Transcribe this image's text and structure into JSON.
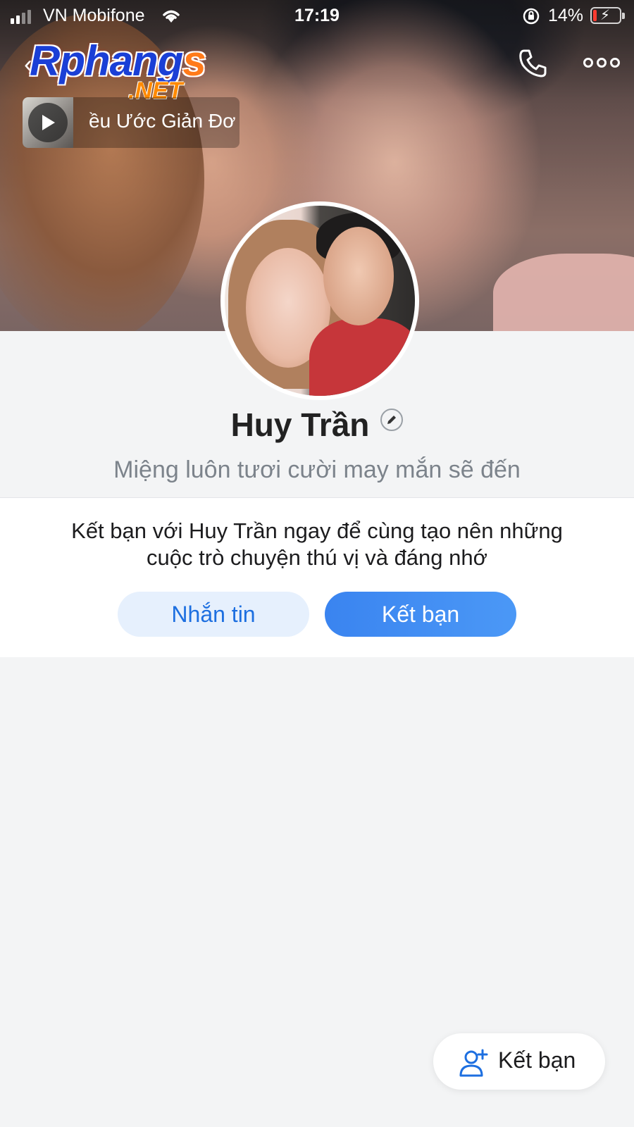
{
  "status_bar": {
    "carrier": "VN Mobifone",
    "time": "17:19",
    "battery_percent": "14%",
    "battery_level": 0.14,
    "icons": [
      "signal-icon",
      "wifi-icon",
      "orientation-lock-icon",
      "battery-charging-icon"
    ]
  },
  "header": {
    "logo_main": "Rphangs",
    "logo_sub": ".NET",
    "icons": [
      "back-icon",
      "phone-icon",
      "more-icon"
    ]
  },
  "music": {
    "title": "ều Ước Giản Đơ",
    "icon": "play-icon"
  },
  "profile": {
    "name": "Huy Trần",
    "bio": "Miệng luôn tươi cười may mắn sẽ đến",
    "edit_icon": "pencil-icon"
  },
  "friend_card": {
    "message_line1": "Kết bạn với Huy Trần ngay để cùng tạo nên những",
    "message_line2": "cuộc trò chuyện thú vị và đáng nhớ",
    "message_button": "Nhắn tin",
    "add_button": "Kết bạn"
  },
  "floating_button": {
    "label": "Kết bạn",
    "icon": "add-friend-icon"
  },
  "colors": {
    "accent": "#3a84f0",
    "accent_light": "#e6f0fd",
    "background": "#f3f4f5",
    "battery_low": "#ff3b30"
  }
}
